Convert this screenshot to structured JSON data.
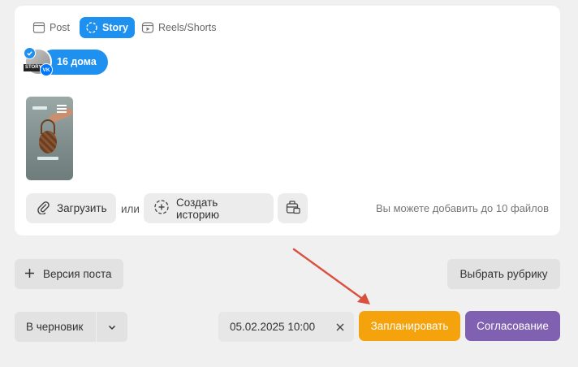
{
  "tabs": [
    {
      "label": "Post",
      "active": false
    },
    {
      "label": "Story",
      "active": true
    },
    {
      "label": "Reels/Shorts",
      "active": false
    }
  ],
  "account": {
    "name": "16 дома",
    "badge_story": "STORY",
    "badge_vk": "VK"
  },
  "media": {
    "count": 1
  },
  "actions": {
    "upload_label": "Загрузить",
    "or_label": "или",
    "create_story_label": "Создать историю",
    "hint": "Вы можете добавить до 10 файлов"
  },
  "post_version_label": "Версия поста",
  "choose_rubric_label": "Выбрать рубрику",
  "draft_select_value": "В черновик",
  "schedule_date": "05.02.2025 10:00",
  "schedule_button_label": "Запланировать",
  "approval_button_label": "Согласование",
  "colors": {
    "accent_blue": "#1e90f0",
    "schedule_orange": "#f5a30c",
    "approval_purple": "#8060b0",
    "arrow_red": "#d9503f"
  },
  "icons": [
    "post-icon",
    "story-icon",
    "reels-icon",
    "check-icon",
    "vk-icon",
    "paperclip-icon",
    "create-story-icon",
    "media-library-icon",
    "plus-icon",
    "chevron-down-icon",
    "close-icon",
    "arrow-annotation-icon"
  ]
}
